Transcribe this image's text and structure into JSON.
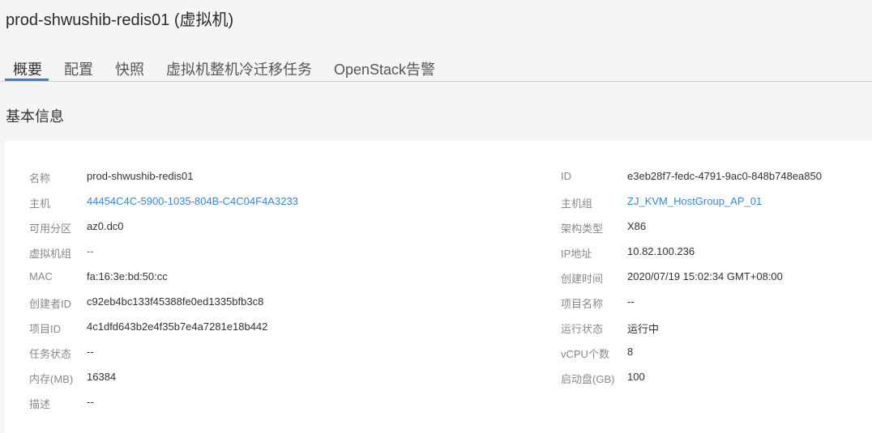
{
  "page": {
    "title": "prod-shwushib-redis01 (虚拟机)"
  },
  "tabs": [
    {
      "label": "概要",
      "active": true
    },
    {
      "label": "配置",
      "active": false
    },
    {
      "label": "快照",
      "active": false
    },
    {
      "label": "虚拟机整机冷迁移任务",
      "active": false
    },
    {
      "label": "OpenStack告警",
      "active": false
    }
  ],
  "section": {
    "title": "基本信息"
  },
  "colors": {
    "accent": "#3a7fc8",
    "link": "#3a86d0",
    "label": "#888888",
    "background": "#f5f5f5",
    "panel": "#ffffff"
  },
  "info_left": [
    {
      "label": "名称",
      "value": "prod-shwushib-redis01",
      "link": false
    },
    {
      "label": "主机",
      "value": "44454C4C-5900-1035-804B-C4C04F4A3233",
      "link": true
    },
    {
      "label": "可用分区",
      "value": "az0.dc0",
      "link": false
    },
    {
      "label": "虚拟机组",
      "value": "--",
      "link": true
    },
    {
      "label": "MAC",
      "value": "fa:16:3e:bd:50:cc",
      "link": false
    },
    {
      "label": "创建者ID",
      "value": "c92eb4bc133f45388fe0ed1335bfb3c8",
      "link": false
    },
    {
      "label": "项目ID",
      "value": "4c1dfd643b2e4f35b7e4a7281e18b442",
      "link": false
    },
    {
      "label": "任务状态",
      "value": "--",
      "link": false
    },
    {
      "label": "内存(MB)",
      "value": "16384",
      "link": false
    },
    {
      "label": "描述",
      "value": "--",
      "link": false
    }
  ],
  "info_right": [
    {
      "label": "ID",
      "value": "e3eb28f7-fedc-4791-9ac0-848b748ea850",
      "link": false
    },
    {
      "label": "主机组",
      "value": "ZJ_KVM_HostGroup_AP_01",
      "link": true
    },
    {
      "label": "架构类型",
      "value": "X86",
      "link": false
    },
    {
      "label": "IP地址",
      "value": "10.82.100.236",
      "link": false
    },
    {
      "label": "创建时间",
      "value": "2020/07/19 15:02:34 GMT+08:00",
      "link": false
    },
    {
      "label": "项目名称",
      "value": "--",
      "link": false
    },
    {
      "label": "运行状态",
      "value": "运行中",
      "link": false
    },
    {
      "label": "vCPU个数",
      "value": "8",
      "link": false
    },
    {
      "label": "启动盘(GB)",
      "value": "100",
      "link": false
    }
  ]
}
